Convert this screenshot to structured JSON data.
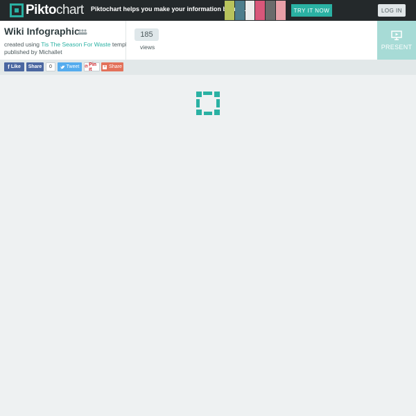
{
  "topbar": {
    "logo_bold": "Pikto",
    "logo_light": "chart",
    "tagline": "Piktochart helps you make your information beautiful",
    "try_label": "TRY IT NOW",
    "login_label": "LOG IN",
    "thumb_colors": [
      "#b8c35c",
      "#4e7d8c",
      "#ececec",
      "#d8577a",
      "#6b6b6b",
      "#e8a0a8"
    ]
  },
  "header": {
    "title": "Wiki Infographic",
    "created_prefix": "created using ",
    "template_name": "Tis The Season For Waste",
    "created_suffix": " template",
    "published_by": "published by Michallet",
    "views_count": "185",
    "views_label": "views",
    "present_label": "PRESENT"
  },
  "social": {
    "fb_like": "Like",
    "fb_share": "Share",
    "share_count": "0",
    "tweet": "Tweet",
    "pin": "Pin it",
    "gshare": "Share"
  },
  "colors": {
    "accent": "#2ab1a3",
    "topbar_bg": "#24292b",
    "present_bg": "#a7dbd6",
    "facebook": "#4b67a1",
    "twitter": "#55acee",
    "google": "#e3715a"
  },
  "icons": [
    "piktochart-logo-icon",
    "people-icon",
    "present-screen-icon",
    "facebook-icon",
    "twitter-icon",
    "pinterest-icon",
    "google-plus-icon",
    "loading-spinner-icon"
  ]
}
